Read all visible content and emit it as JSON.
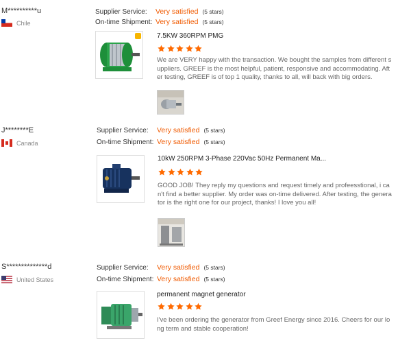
{
  "colors": {
    "accent": "#f05a00",
    "star": "#ff6a00"
  },
  "reviews": [
    {
      "buyer": "M**********u",
      "country": "Chile",
      "flag": "chile-flag",
      "supplier_label": "Supplier Service:",
      "supplier_value": "Very satisfied",
      "supplier_stars": "(5 stars)",
      "shipment_label": "On-time Shipment:",
      "shipment_value": "Very satisfied",
      "shipment_stars": "(5 stars)",
      "product_title": "7.5KW 360RPM PMG",
      "rating": 5,
      "text": "We are VERY happy with the transaction. We bought the samples from different suppliers. GREEF is the most helpful, patient, responsive and accommodating. After testing, GREEF is of top 1 quality, thanks to all, will back with big orders."
    },
    {
      "buyer": "J********E",
      "country": "Canada",
      "flag": "canada-flag",
      "supplier_label": "Supplier Service:",
      "supplier_value": "Very satisfied",
      "supplier_stars": "(5 stars)",
      "shipment_label": "On-time Shipment:",
      "shipment_value": "Very satisfied",
      "shipment_stars": "(5 stars)",
      "product_title": "10kW 250RPM 3-Phase 220Vac 50Hz Permanent Ma...",
      "rating": 5,
      "text": "GOOD JOB! They reply my questions and request timely and profeesstional, i can't find a better supplier. My order was on-time delivered. After testing, the generator is the right one for our project, thanks! I love you all!"
    },
    {
      "buyer": "S**************d",
      "country": "United States",
      "flag": "us-flag",
      "supplier_label": "Supplier Service:",
      "supplier_value": "Very satisfied",
      "supplier_stars": "(5 stars)",
      "shipment_label": "On-time Shipment:",
      "shipment_value": "Very satisfied",
      "shipment_stars": "(5 stars)",
      "product_title": "permanent magnet generator",
      "rating": 5,
      "text": "I've been ordering the generator from Greef Energy since 2016. Cheers for our long term and stable cooperation!"
    }
  ]
}
